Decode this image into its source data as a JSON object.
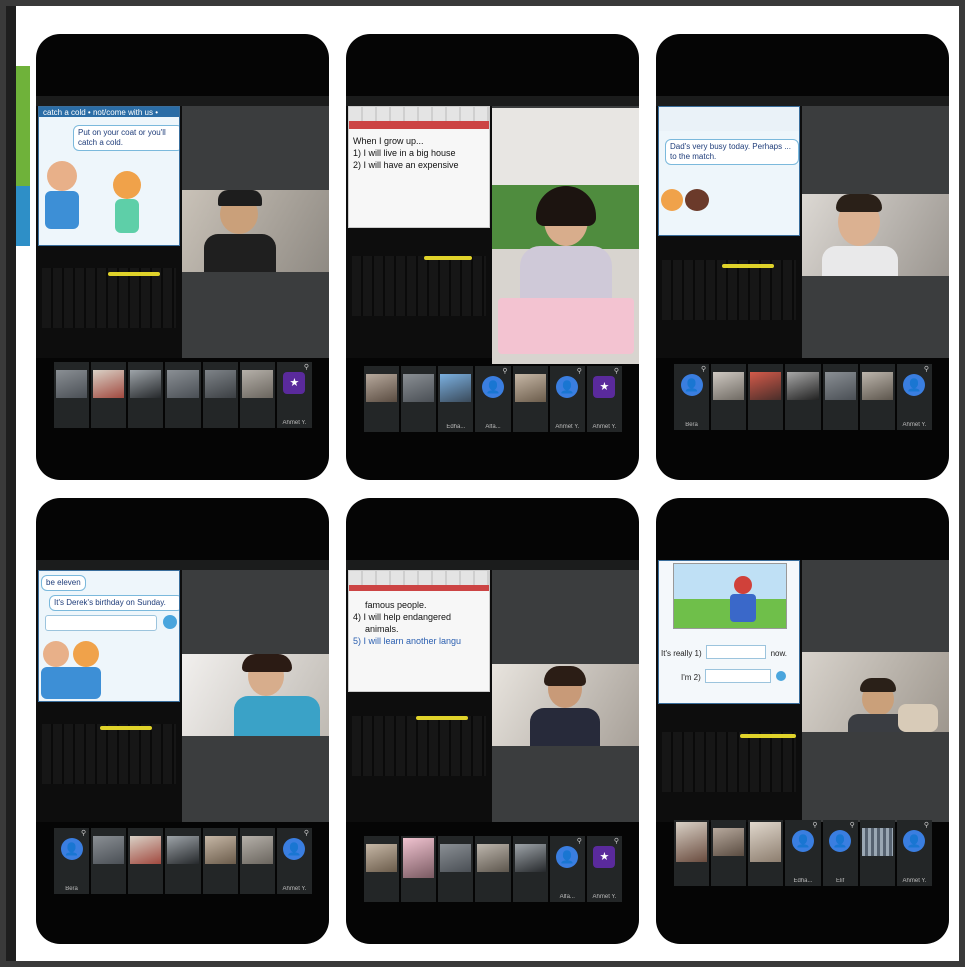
{
  "phones": [
    {
      "slide_top_label": "catch a cold • not/come with us •",
      "slide_bubble": "Put on your coat or you'll catch a cold.",
      "strip": [
        {
          "kind": "photo",
          "name": ""
        },
        {
          "kind": "photo",
          "name": ""
        },
        {
          "kind": "photo",
          "name": ""
        },
        {
          "kind": "photo",
          "name": ""
        },
        {
          "kind": "photo",
          "name": ""
        },
        {
          "kind": "photo",
          "name": ""
        },
        {
          "kind": "app",
          "name": "Ahmet Y.",
          "icon": "★"
        }
      ]
    },
    {
      "slide_lines": [
        "When I grow up...",
        "1) I will live in a big house",
        "2) I will have an expensive"
      ],
      "strip": [
        {
          "kind": "photo",
          "name": ""
        },
        {
          "kind": "photo",
          "name": ""
        },
        {
          "kind": "photo",
          "name": "Edha..."
        },
        {
          "kind": "avatar",
          "name": "Alfa...",
          "icon": "👤"
        },
        {
          "kind": "photo",
          "name": ""
        },
        {
          "kind": "avatar",
          "name": "Ahmet Y.",
          "icon": "👤"
        },
        {
          "kind": "app",
          "name": "Ahmet Y.",
          "icon": "★"
        }
      ]
    },
    {
      "slide_bubble": "Dad's very busy today. Perhaps ... to the match.",
      "strip": [
        {
          "kind": "avatar",
          "name": "Bera",
          "icon": "👤"
        },
        {
          "kind": "photo",
          "name": ""
        },
        {
          "kind": "photo",
          "name": ""
        },
        {
          "kind": "photo",
          "name": ""
        },
        {
          "kind": "photo",
          "name": ""
        },
        {
          "kind": "photo",
          "name": ""
        },
        {
          "kind": "avatar",
          "name": "Ahmet Y.",
          "icon": "👤"
        }
      ]
    },
    {
      "slide_top_label": "be eleven",
      "slide_bubble": "It's Derek's birthday on Sunday.",
      "strip": [
        {
          "kind": "avatar",
          "name": "Bera",
          "icon": "👤"
        },
        {
          "kind": "photo",
          "name": ""
        },
        {
          "kind": "photo",
          "name": ""
        },
        {
          "kind": "photo",
          "name": ""
        },
        {
          "kind": "photo",
          "name": ""
        },
        {
          "kind": "photo",
          "name": ""
        },
        {
          "kind": "avatar",
          "name": "Ahmet Y.",
          "icon": "👤"
        }
      ]
    },
    {
      "slide_lines": [
        "famous people.",
        "4) I will help endangered",
        "animals.",
        "5) I will learn another langu"
      ],
      "strip": [
        {
          "kind": "photo",
          "name": ""
        },
        {
          "kind": "photo",
          "name": ""
        },
        {
          "kind": "photo",
          "name": ""
        },
        {
          "kind": "photo",
          "name": ""
        },
        {
          "kind": "photo",
          "name": ""
        },
        {
          "kind": "avatar",
          "name": "Alfa...",
          "icon": "👤"
        },
        {
          "kind": "app",
          "name": "Ahmet Y.",
          "icon": "★"
        }
      ]
    },
    {
      "slide_lines": [
        "It's really 1)",
        "now.",
        "I'm 2)"
      ],
      "strip": [
        {
          "kind": "photo",
          "name": ""
        },
        {
          "kind": "photo",
          "name": ""
        },
        {
          "kind": "photo",
          "name": ""
        },
        {
          "kind": "avatar",
          "name": "Edha...",
          "icon": "👤"
        },
        {
          "kind": "avatar",
          "name": "Elif",
          "icon": "👤"
        },
        {
          "kind": "photo",
          "name": ""
        },
        {
          "kind": "avatar",
          "name": "Ahmet Y.",
          "icon": "👤"
        }
      ]
    }
  ]
}
